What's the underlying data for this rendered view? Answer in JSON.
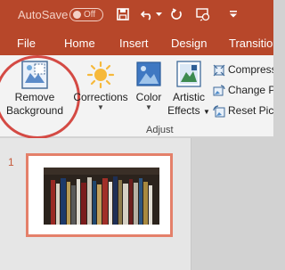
{
  "titlebar": {
    "autosave_label": "AutoSave",
    "autosave_state": "Off",
    "icons": [
      "save-icon",
      "undo-icon",
      "redo-icon",
      "slideshow-icon",
      "customize-qat-icon"
    ]
  },
  "tabs": [
    "File",
    "Home",
    "Insert",
    "Design",
    "Transition"
  ],
  "ribbon": {
    "remove_background": {
      "line1": "Remove",
      "line2": "Background"
    },
    "corrections": "Corrections",
    "color": "Color",
    "artistic_effects": {
      "line1": "Artistic",
      "line2": "Effects"
    },
    "compress": "Compress",
    "change_picture": "Change P",
    "reset_picture": "Reset Pict",
    "group_label": "Adjust"
  },
  "slides_panel": {
    "slide_number": "1"
  },
  "colors": {
    "accent": "#b7472a",
    "highlight_circle": "#d44a44",
    "slide_border": "#e4806a"
  }
}
